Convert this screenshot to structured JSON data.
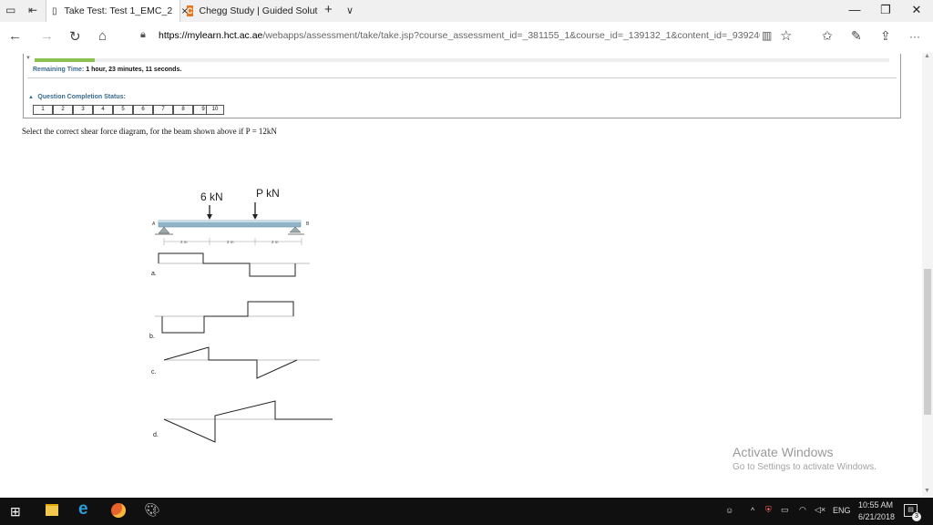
{
  "browser": {
    "tabs": [
      {
        "label": "Take Test: Test 1_EMC_2",
        "close": "×",
        "active": true
      },
      {
        "label": "Chegg Study | Guided Solut",
        "active": false
      }
    ],
    "new_tab": "+",
    "tab_menu": "∨",
    "window_controls": {
      "minimize": "—",
      "restore": "❐",
      "close": "✕"
    },
    "url_host": "https://mylearn.hct.ac.ae",
    "url_path": "/webapps/assessment/take/take.jsp?course_assessment_id=_381155_1&course_id=_139132_1&content_id=_9392400_1&questi",
    "more": "···"
  },
  "test": {
    "remaining_label": "Remaining Time:",
    "remaining_value": "1 hour, 23 minutes, 11 seconds.",
    "completion_label": "Question Completion Status:",
    "question_numbers": [
      "1",
      "2",
      "3",
      "4",
      "5",
      "6",
      "7",
      "8",
      "9",
      "10"
    ],
    "question_text": "Select the correct shear force diagram, for the beam shown above if P = 12kN"
  },
  "figure": {
    "load1": "6 kN",
    "load2": "P kN",
    "support_a": "A",
    "support_b": "B",
    "span1": "2 m",
    "span2": "2 m",
    "span3": "2 m",
    "option_a": "a.",
    "option_b": "b.",
    "option_c": "c.",
    "option_d": "d."
  },
  "watermark": {
    "title": "Activate Windows",
    "subtitle": "Go to Settings to activate Windows."
  },
  "taskbar": {
    "lang": "ENG",
    "time": "10:55 AM",
    "date": "6/21/2018",
    "notifications": "3"
  }
}
